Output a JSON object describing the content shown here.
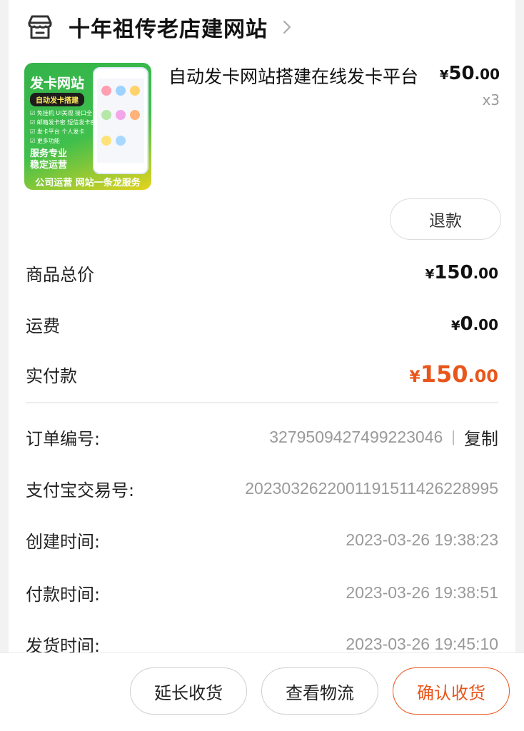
{
  "shop": {
    "name": "十年祖传老店建网站"
  },
  "product": {
    "title": "自动发卡网站搭建在线发卡平台",
    "price_currency": "¥",
    "price_int": "50",
    "price_dec": ".00",
    "quantity": "x3",
    "image": {
      "title": "发卡网站",
      "badge": "自动发卡搭建",
      "features": [
        "☑ 免挂机  UI美观  接口全",
        "☑ 邮箱发卡密  短信发卡密",
        "☑ 发卡平台  个人发卡",
        "☑ 更多功能"
      ],
      "slogan_1": "服务专业",
      "slogan_2": "稳定运营",
      "footer": "公司运营 网站一条龙服务"
    },
    "refund_label": "退款"
  },
  "summary": {
    "goods_total_label": "商品总价",
    "goods_total_cur": "¥",
    "goods_total_int": "150",
    "goods_total_dec": ".00",
    "shipping_label": "运费",
    "shipping_cur": "¥",
    "shipping_int": "0",
    "shipping_dec": ".00",
    "paid_label": "实付款",
    "paid_cur": "¥",
    "paid_int": "150",
    "paid_dec": ".00"
  },
  "order_info": {
    "order_no_label": "订单编号:",
    "order_no": "3279509427499223046",
    "separator": "|",
    "copy_label": "复制",
    "alipay_label": "支付宝交易号:",
    "alipay_no": "2023032622001191511426228995",
    "created_label": "创建时间:",
    "created_at": "2023-03-26 19:38:23",
    "paid_time_label": "付款时间:",
    "paid_at": "2023-03-26 19:38:51",
    "shipped_label": "发货时间:",
    "shipped_at": "2023-03-26 19:45:10"
  },
  "actions": {
    "extend_label": "延长收货",
    "logistics_label": "查看物流",
    "confirm_label": "确认收货"
  },
  "colors": {
    "accent": "#e8561c",
    "muted": "#9a9a9a"
  },
  "icons": {
    "shop": "store-icon",
    "chevron": "chevron-right-icon"
  }
}
